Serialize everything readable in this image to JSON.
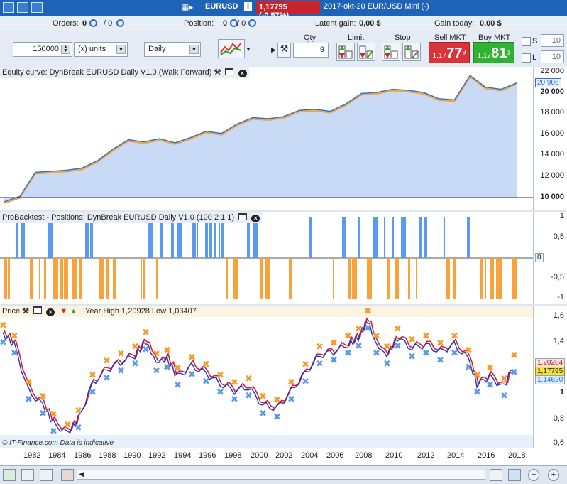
{
  "titlebar": {
    "symbol": "EURUSD",
    "info_icon": "i",
    "price_change": "1,17795 (-0,57%)",
    "date_title": "2017-okt-20 EUR/USD Mini (-)"
  },
  "infobar": {
    "orders_label": "Orders:",
    "orders_value": "0",
    "orders_total": "/ 0",
    "position_label": "Position:",
    "position_value": "0",
    "position_total": "/ 0",
    "latent_label": "Latent gain:",
    "latent_value": "0,00 $",
    "gain_label": "Gain today:",
    "gain_value": "0,00 $"
  },
  "toolbar": {
    "amount": "150000",
    "units": "(x) units",
    "period": "Daily",
    "qty_label": "Qty",
    "qty_value": "9",
    "limit_label": "Limit",
    "stop_label": "Stop",
    "sell_label": "Sell MKT",
    "sell_prefix": "1,17",
    "sell_big": "77",
    "sell_sup": "9",
    "buy_label": "Buy MKT",
    "buy_prefix": "1,17",
    "buy_big": "81",
    "buy_sup": "1",
    "s_label": "S",
    "s_value": "10",
    "l_label": "L",
    "l_value": "10"
  },
  "equity": {
    "title": "Equity curve: DynBreak EURUSD Daily V1.0 (Walk Forward)",
    "ticks": [
      "22 000",
      "20 000",
      "18 000",
      "16 000",
      "14 000",
      "12 000",
      "10 000"
    ],
    "tag": "20 906",
    "curve_y": [
      9.6,
      10.1,
      12.4,
      12.5,
      12.6,
      12.8,
      13.5,
      14.6,
      15.5,
      15.3,
      15.6,
      15.2,
      15.7,
      16.3,
      16.1,
      17.0,
      17.6,
      17.5,
      17.7,
      18.3,
      18.4,
      18.2,
      18.9,
      19.9,
      20.0,
      20.3,
      20.2,
      20.0,
      19.4,
      19.3,
      21.6,
      20.5,
      20.3,
      20.9
    ],
    "colors": {
      "line": "#2f6fd6",
      "fill": "#c9daf6",
      "overlay": "#f6a531"
    }
  },
  "positions": {
    "title": "ProBacktest - Positions: DynBreak EURUSD Daily V1.0 (100 2 1 1)",
    "ticks": [
      "1",
      "0,5",
      "0",
      "-0,5",
      "-1"
    ],
    "tag": "0",
    "colors": {
      "long": "#5a9af0",
      "short": "#f7a23a"
    }
  },
  "price": {
    "title": "Price",
    "annotation": "Year High 1,20928 Low 1,03407",
    "watermark": "© IT-Finance.com Data is indicative",
    "ticks": [
      "1,6",
      "1,4",
      "1,2",
      "1",
      "0,8",
      "0,6"
    ],
    "tags": [
      "1,20284",
      "1,17795",
      "1,14620"
    ],
    "colors": {
      "price": "#2233cc",
      "ma_red": "#d61f26",
      "marker_orange": "#f79a2a",
      "marker_blue": "#5a9be8"
    }
  },
  "xaxis": {
    "labels": [
      "1982",
      "1984",
      "1986",
      "1988",
      "1990",
      "1992",
      "1994",
      "1996",
      "1998",
      "2000",
      "2002",
      "2004",
      "2006",
      "2008",
      "2010",
      "2012",
      "2014",
      "2016",
      "2018"
    ]
  },
  "bottom": {
    "icons": [
      "refresh-icon",
      "export-icon",
      "report-icon",
      "table-icon",
      "zoom-in-icon",
      "zoom-out-icon"
    ]
  }
}
